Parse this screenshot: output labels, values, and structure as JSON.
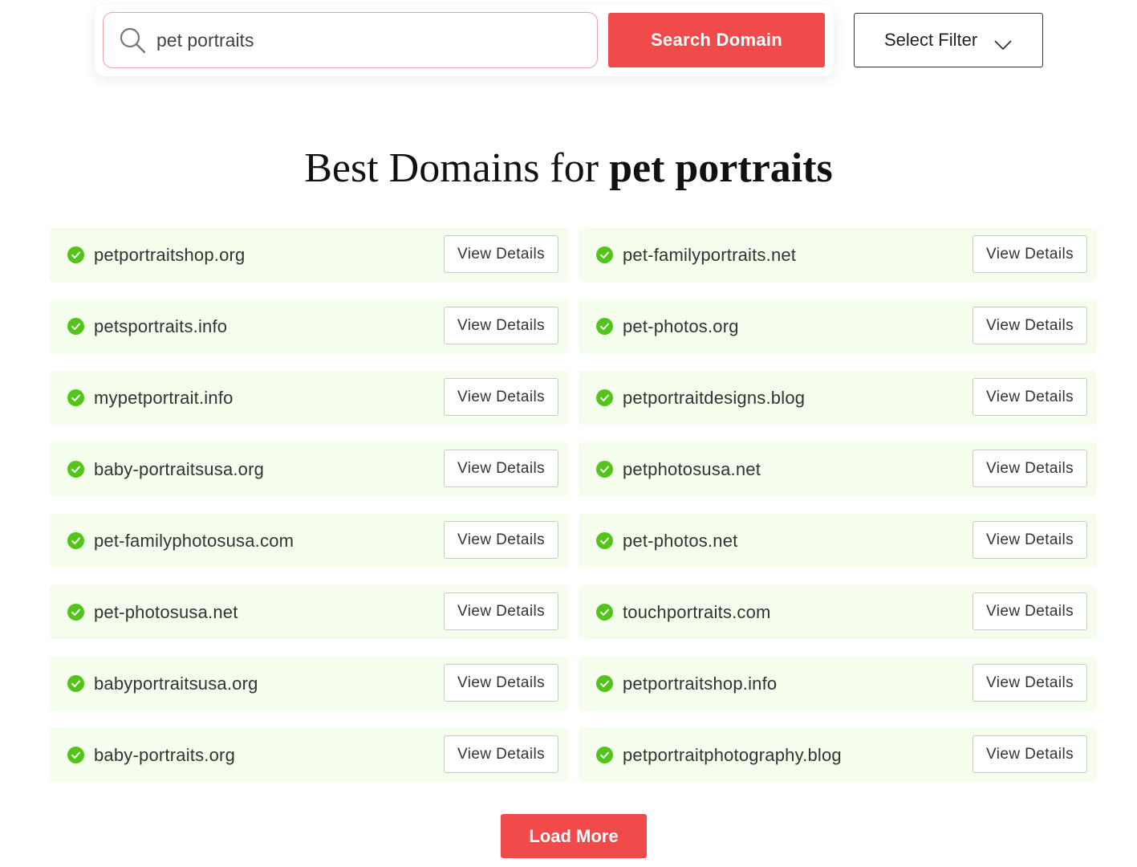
{
  "search": {
    "value": "pet portraits",
    "button_label": "Search Domain"
  },
  "filter": {
    "label": "Select Filter"
  },
  "title": {
    "prefix": "Best Domains for ",
    "keyword": "pet portraits"
  },
  "domains": [
    "petportraitshop.org",
    "pet-familyportraits.net",
    "petsportraits.info",
    "pet-photos.org",
    "mypetportrait.info",
    "petportraitdesigns.blog",
    "baby-portraitsusa.org",
    "petphotosusa.net",
    "pet-familyphotosusa.com",
    "pet-photos.net",
    "pet-photosusa.net",
    "touchportraits.com",
    "babyportraitsusa.org",
    "petportraitshop.info",
    "baby-portraits.org",
    "petportraitphotography.blog"
  ],
  "view_details_label": "View Details",
  "load_more_label": "Load More",
  "colors": {
    "accent": "#f04a4a",
    "row_bg": "#f5fdec",
    "check": "#52c41a"
  }
}
